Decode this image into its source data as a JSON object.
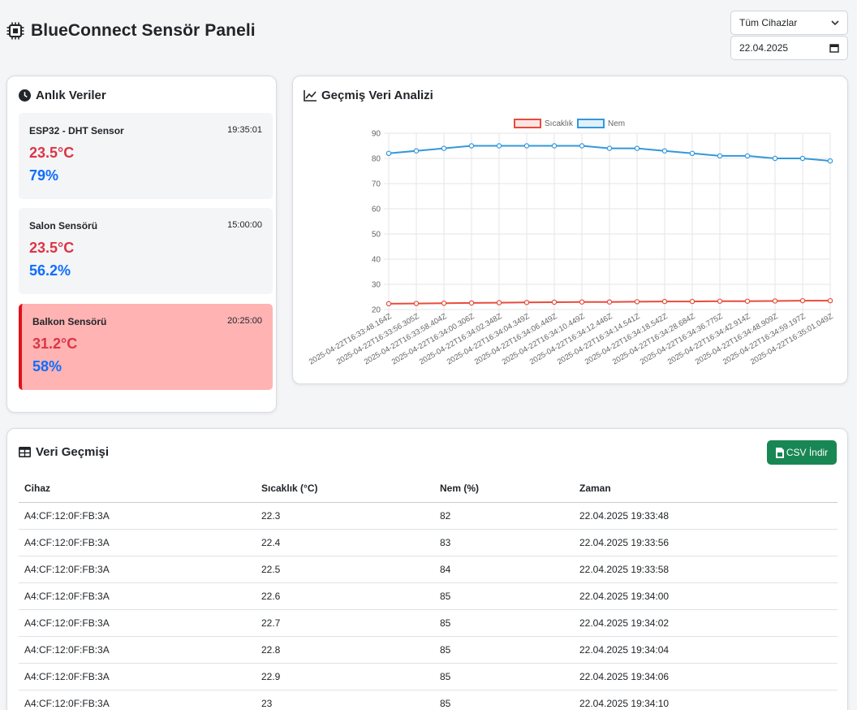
{
  "header": {
    "title": "BlueConnect Sensör Paneli",
    "icon": "cpu-chip-icon"
  },
  "filters": {
    "device_select": "Tüm Cihazlar",
    "date": "22.04.2025"
  },
  "live": {
    "title": "Anlık Veriler",
    "sensors": [
      {
        "name": "ESP32 - DHT Sensor",
        "time": "19:35:01",
        "temperature": "23.5°C",
        "humidity": "79%"
      },
      {
        "name": "Salon Sensörü",
        "time": "15:00:00",
        "temperature": "23.5°C",
        "humidity": "56.2%"
      },
      {
        "name": "Balkon Sensörü",
        "time": "20:25:00",
        "temperature": "31.2°C",
        "humidity": "58%",
        "alert": true
      }
    ]
  },
  "history_chart": {
    "title": "Geçmiş Veri Analizi",
    "colors": {
      "temperature": "#e74c3c",
      "humidity": "#3498db"
    }
  },
  "chart_data": {
    "type": "line",
    "categories": [
      "2025-04-22T16:33:48.164Z",
      "2025-04-22T16:33:56.305Z",
      "2025-04-22T16:33:58.404Z",
      "2025-04-22T16:34:00.306Z",
      "2025-04-22T16:34:02.348Z",
      "2025-04-22T16:34:04.349Z",
      "2025-04-22T16:34:06.449Z",
      "2025-04-22T16:34:10.449Z",
      "2025-04-22T16:34:12.446Z",
      "2025-04-22T16:34:14.541Z",
      "2025-04-22T16:34:18.542Z",
      "2025-04-22T16:34:28.684Z",
      "2025-04-22T16:34:36.775Z",
      "2025-04-22T16:34:42.914Z",
      "2025-04-22T16:34:48.909Z",
      "2025-04-22T16:34:59.197Z",
      "2025-04-22T16:35:01.049Z"
    ],
    "series": [
      {
        "name": "Sıcaklık",
        "color": "#e74c3c",
        "values": [
          22.3,
          22.4,
          22.5,
          22.6,
          22.7,
          22.8,
          22.9,
          23,
          23,
          23.1,
          23.2,
          23.2,
          23.3,
          23.3,
          23.4,
          23.5,
          23.5
        ]
      },
      {
        "name": "Nem",
        "color": "#3498db",
        "values": [
          82,
          83,
          84,
          85,
          85,
          85,
          85,
          85,
          84,
          84,
          83,
          82,
          81,
          81,
          80,
          80,
          79
        ]
      }
    ],
    "ylim": [
      20,
      90
    ],
    "yticks": [
      20,
      30,
      40,
      50,
      60,
      70,
      80,
      90
    ],
    "grid": true,
    "legend": "top"
  },
  "table": {
    "title": "Veri Geçmişi",
    "csv_label": "CSV İndir",
    "headers": [
      "Cihaz",
      "Sıcaklık (°C)",
      "Nem (%)",
      "Zaman"
    ],
    "rows": [
      [
        "A4:CF:12:0F:FB:3A",
        "22.3",
        "82",
        "22.04.2025 19:33:48"
      ],
      [
        "A4:CF:12:0F:FB:3A",
        "22.4",
        "83",
        "22.04.2025 19:33:56"
      ],
      [
        "A4:CF:12:0F:FB:3A",
        "22.5",
        "84",
        "22.04.2025 19:33:58"
      ],
      [
        "A4:CF:12:0F:FB:3A",
        "22.6",
        "85",
        "22.04.2025 19:34:00"
      ],
      [
        "A4:CF:12:0F:FB:3A",
        "22.7",
        "85",
        "22.04.2025 19:34:02"
      ],
      [
        "A4:CF:12:0F:FB:3A",
        "22.8",
        "85",
        "22.04.2025 19:34:04"
      ],
      [
        "A4:CF:12:0F:FB:3A",
        "22.9",
        "85",
        "22.04.2025 19:34:06"
      ],
      [
        "A4:CF:12:0F:FB:3A",
        "23",
        "85",
        "22.04.2025 19:34:10"
      ]
    ]
  }
}
